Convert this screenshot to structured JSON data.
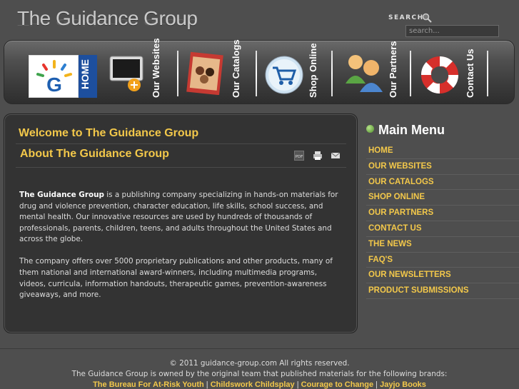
{
  "header": {
    "logo_text": "The Guidance Group",
    "search_label": "SEARCH",
    "search_placeholder": "search..."
  },
  "nav": [
    {
      "label": "HOME",
      "icon": "home-g-logo-icon"
    },
    {
      "label": "Our Websites",
      "icon": "monitor-icon"
    },
    {
      "label": "Our Catalogs",
      "icon": "catalog-icon"
    },
    {
      "label": "Shop Online",
      "icon": "shopping-cart-icon"
    },
    {
      "label": "Our Partners",
      "icon": "people-icon"
    },
    {
      "label": "Contact Us",
      "icon": "lifebuoy-icon"
    }
  ],
  "content": {
    "welcome_title": "Welcome to The Guidance Group",
    "about_title": "About The Guidance Group",
    "tools": {
      "pdf": "PDF",
      "print": "print-icon",
      "email": "email-icon"
    },
    "paragraph1_bold": "The Guidance Group",
    "paragraph1_rest": " is a publishing company specializing in hands-on materials for drug and violence prevention, character education, life skills, school success, and mental health. Our innovative resources are used by hundreds of thousands of professionals, parents, children, teens, and adults throughout the United States and across the globe.",
    "paragraph2": "The company offers over 5000 proprietary publications and other products, many of them national and international award-winners, including multimedia programs, videos, curricula, information handouts, therapeutic games, prevention-awareness giveaways, and more."
  },
  "menu": {
    "title": "Main Menu",
    "items": [
      "HOME",
      "OUR WEBSITES",
      "OUR CATALOGS",
      "SHOP ONLINE",
      "OUR PARTNERS",
      "CONTACT US",
      "THE NEWS",
      "FAQ'S",
      "OUR NEWSLETTERS",
      "PRODUCT SUBMISSIONS"
    ]
  },
  "footer": {
    "copyright": "© 2011 guidance-group.com All rights reserved.",
    "owned": "The Guidance Group is owned by the original team that published materials for the following brands:",
    "brands": [
      "The Bureau For At-Risk Youth",
      "Childswork Childsplay",
      "Courage to Change",
      "Jayjo Books"
    ]
  },
  "colors": {
    "accent_yellow": "#f3c84a",
    "background": "#4e4e4e",
    "content_bg": "#333333"
  }
}
